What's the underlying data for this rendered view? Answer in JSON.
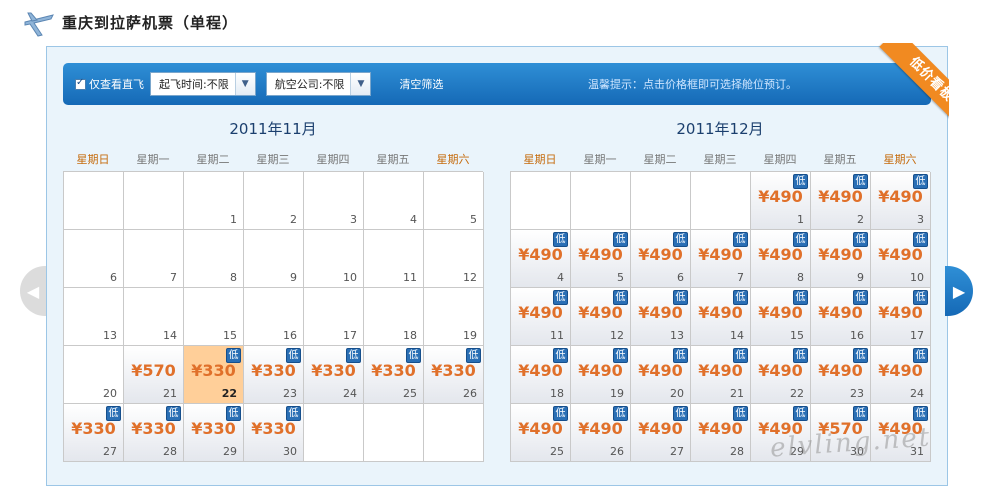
{
  "page": {
    "title": "重庆到拉萨机票（单程）"
  },
  "filters": {
    "direct_only_label": "仅查看直飞",
    "departure_time": "起飞时间:不限",
    "airline": "航空公司:不限",
    "clear_label": "清空筛选",
    "tip": "温馨提示：点击价格框即可选择舱位预订。"
  },
  "ribbon": {
    "label": "低价看板"
  },
  "weekdays": [
    "星期日",
    "星期一",
    "星期二",
    "星期三",
    "星期四",
    "星期五",
    "星期六"
  ],
  "low_badge": "低",
  "months": [
    {
      "title": "2011年11月",
      "cells": [
        {
          "day": ""
        },
        {
          "day": ""
        },
        {
          "day": "1"
        },
        {
          "day": "2"
        },
        {
          "day": "3"
        },
        {
          "day": "4"
        },
        {
          "day": "5"
        },
        {
          "day": "6"
        },
        {
          "day": "7"
        },
        {
          "day": "8"
        },
        {
          "day": "9"
        },
        {
          "day": "10"
        },
        {
          "day": "11"
        },
        {
          "day": "12"
        },
        {
          "day": "13"
        },
        {
          "day": "14"
        },
        {
          "day": "15"
        },
        {
          "day": "16"
        },
        {
          "day": "17"
        },
        {
          "day": "18"
        },
        {
          "day": "19"
        },
        {
          "day": "20"
        },
        {
          "day": "21",
          "price": "¥570"
        },
        {
          "day": "22",
          "price": "¥330",
          "low": true,
          "selected": true
        },
        {
          "day": "23",
          "price": "¥330",
          "low": true
        },
        {
          "day": "24",
          "price": "¥330",
          "low": true
        },
        {
          "day": "25",
          "price": "¥330",
          "low": true
        },
        {
          "day": "26",
          "price": "¥330",
          "low": true
        },
        {
          "day": "27",
          "price": "¥330",
          "low": true
        },
        {
          "day": "28",
          "price": "¥330",
          "low": true
        },
        {
          "day": "29",
          "price": "¥330",
          "low": true
        },
        {
          "day": "30",
          "price": "¥330",
          "low": true
        },
        {
          "day": ""
        },
        {
          "day": ""
        },
        {
          "day": ""
        }
      ]
    },
    {
      "title": "2011年12月",
      "cells": [
        {
          "day": ""
        },
        {
          "day": ""
        },
        {
          "day": ""
        },
        {
          "day": ""
        },
        {
          "day": "1",
          "price": "¥490",
          "low": true
        },
        {
          "day": "2",
          "price": "¥490",
          "low": true
        },
        {
          "day": "3",
          "price": "¥490",
          "low": true
        },
        {
          "day": "4",
          "price": "¥490",
          "low": true
        },
        {
          "day": "5",
          "price": "¥490",
          "low": true
        },
        {
          "day": "6",
          "price": "¥490",
          "low": true
        },
        {
          "day": "7",
          "price": "¥490",
          "low": true
        },
        {
          "day": "8",
          "price": "¥490",
          "low": true
        },
        {
          "day": "9",
          "price": "¥490",
          "low": true
        },
        {
          "day": "10",
          "price": "¥490",
          "low": true
        },
        {
          "day": "11",
          "price": "¥490",
          "low": true
        },
        {
          "day": "12",
          "price": "¥490",
          "low": true
        },
        {
          "day": "13",
          "price": "¥490",
          "low": true
        },
        {
          "day": "14",
          "price": "¥490",
          "low": true
        },
        {
          "day": "15",
          "price": "¥490",
          "low": true
        },
        {
          "day": "16",
          "price": "¥490",
          "low": true
        },
        {
          "day": "17",
          "price": "¥490",
          "low": true
        },
        {
          "day": "18",
          "price": "¥490",
          "low": true
        },
        {
          "day": "19",
          "price": "¥490",
          "low": true
        },
        {
          "day": "20",
          "price": "¥490",
          "low": true
        },
        {
          "day": "21",
          "price": "¥490",
          "low": true
        },
        {
          "day": "22",
          "price": "¥490",
          "low": true
        },
        {
          "day": "23",
          "price": "¥490",
          "low": true
        },
        {
          "day": "24",
          "price": "¥490",
          "low": true
        },
        {
          "day": "25",
          "price": "¥490",
          "low": true
        },
        {
          "day": "26",
          "price": "¥490",
          "low": true
        },
        {
          "day": "27",
          "price": "¥490",
          "low": true
        },
        {
          "day": "28",
          "price": "¥490",
          "low": true
        },
        {
          "day": "29",
          "price": "¥490",
          "low": true
        },
        {
          "day": "30",
          "price": "¥570",
          "low": true
        },
        {
          "day": "31",
          "price": "¥490",
          "low": true
        }
      ]
    }
  ],
  "watermark": "elvling.net",
  "colors": {
    "accent": "#1a73c4",
    "price": "#e0702a",
    "selected": "#ffcf99",
    "weekend": "#c56b0d",
    "ribbon": "#f18a21"
  }
}
